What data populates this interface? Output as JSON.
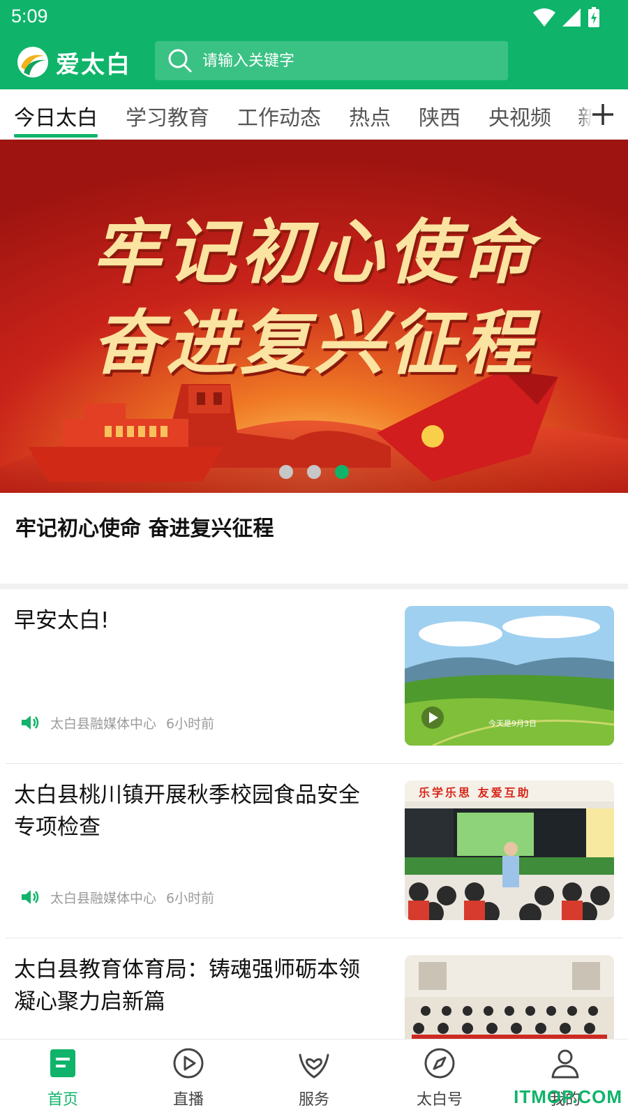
{
  "status_bar": {
    "time": "5:09"
  },
  "app": {
    "name": "爱太白"
  },
  "search": {
    "placeholder": "请输入关键字"
  },
  "tabs": [
    {
      "label": "今日太白",
      "active": true
    },
    {
      "label": "学习教育"
    },
    {
      "label": "工作动态"
    },
    {
      "label": "热点"
    },
    {
      "label": "陕西"
    },
    {
      "label": "央视频"
    },
    {
      "label": "新"
    }
  ],
  "banner": {
    "image_text_line1": "牢记初心使命",
    "image_text_line2": "奋进复兴征程",
    "slide_count": 3,
    "active_slide": 3
  },
  "headline": "牢记初心使命 奋进复兴征程",
  "news": [
    {
      "title": "早安太白!",
      "source": "太白县融媒体中心",
      "time": "6小时前",
      "thumb_caption": "今天是9月3日",
      "has_video": true
    },
    {
      "title": "太白县桃川镇开展秋季校园食品安全专项检查",
      "source": "太白县融媒体中心",
      "time": "6小时前",
      "thumb_caption": "乐学乐思 友爱互助"
    },
    {
      "title": "太白县教育体育局：铸魂强师砺本领 凝心聚力启新篇"
    }
  ],
  "bottom_nav": [
    {
      "label": "首页",
      "icon": "home-doc-icon",
      "active": true
    },
    {
      "label": "直播",
      "icon": "play-circle-icon"
    },
    {
      "label": "服务",
      "icon": "heart-hands-icon"
    },
    {
      "label": "太白号",
      "icon": "compass-icon"
    },
    {
      "label": "我的",
      "icon": "person-icon"
    }
  ],
  "watermark": "ITMOP.COM",
  "colors": {
    "accent": "#0fb46a",
    "banner_red": "#c8241a",
    "banner_gold": "#fbe3a1"
  }
}
